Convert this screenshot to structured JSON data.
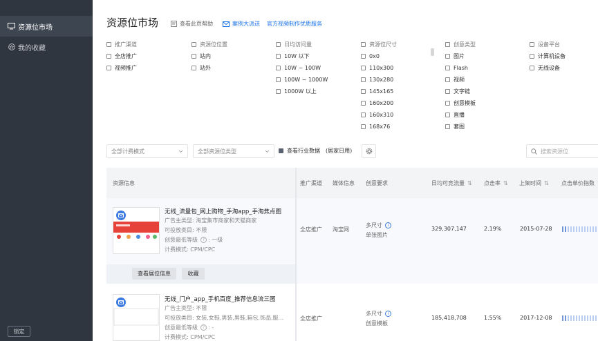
{
  "sidebar": {
    "items": [
      {
        "label": "资源位市场",
        "icon": "monitor-icon"
      },
      {
        "label": "我的收藏",
        "icon": "star-icon"
      }
    ],
    "lock_label": "锁定"
  },
  "header": {
    "title": "资源位市场",
    "help_link": "查看此页帮助",
    "case_link": "案例大派送",
    "video_link": "官方视频制作优质服务"
  },
  "filters": [
    {
      "title": "推广渠道",
      "options": [
        "全店推广",
        "视频推广"
      ]
    },
    {
      "title": "资源位位置",
      "options": [
        "站内",
        "站外"
      ]
    },
    {
      "title": "日均访问量",
      "options": [
        "10W 以下",
        "10W ~ 100W",
        "100W ~ 1000W",
        "1000W 以上"
      ]
    },
    {
      "title": "资源位尺寸",
      "options": [
        "0x0",
        "110x300",
        "130x280",
        "145x165",
        "160x200",
        "160x310",
        "168x76"
      ]
    },
    {
      "title": "创意类型",
      "options": [
        "图片",
        "Flash",
        "视频",
        "文字链",
        "创意模板",
        "直播",
        "套图"
      ]
    },
    {
      "title": "设备平台",
      "options": [
        "计算机设备",
        "无线设备"
      ]
    }
  ],
  "toolbar": {
    "billing_select": "全部计费模式",
    "type_select": "全部资源位类型",
    "industry_label": "查看行业数据",
    "industry_value": "(居家日用)",
    "search_placeholder": "搜索资源位"
  },
  "table": {
    "headers": {
      "info": "资源信息",
      "channel": "推广渠道",
      "media": "媒体信息",
      "creative": "创意要求",
      "traffic": "日均可竞流量",
      "ctr": "点击率",
      "date": "上架时间",
      "price_index": "点击单价指数"
    },
    "rows": [
      {
        "title": "无线_流量包_网上购物_手淘app_手淘焦点图",
        "type_label": "广告主类型:",
        "type_value": "淘宝集市商家和天猫商家",
        "category_label": "可投放类目:",
        "category_value": "不限",
        "level_label": "创意最低等级",
        "level_value": ": 一级",
        "billing_label": "计费模式:",
        "billing_value": "CPM/CPC",
        "channel": "全店推广",
        "media": "淘宝网",
        "size": "多尺寸",
        "creative_type": "单张图片",
        "traffic": "329,307,147",
        "ctr": "2.19%",
        "date": "2015-07-28",
        "price_level": 0.15
      },
      {
        "title": "无线_门户_app_手机百度_推荐信息流三图",
        "type_label": "广告主类型:",
        "type_value": "不限",
        "category_label": "可投放类目:",
        "category_value": "女装,女鞋,男装,男鞋,箱包,饰品,服...",
        "level_label": "创意最低等级",
        "level_value": ": -",
        "billing_label": "计费模式:",
        "billing_value": "CPM/CPC",
        "channel": "全店推广",
        "media": "",
        "size": "多尺寸",
        "creative_type": "创意模板",
        "traffic": "185,418,708",
        "ctr": "1.55%",
        "date": "2017-12-08",
        "price_level": 0.15
      }
    ],
    "actions": {
      "view_label": "查看展位信息",
      "collect_label": "收藏"
    }
  }
}
